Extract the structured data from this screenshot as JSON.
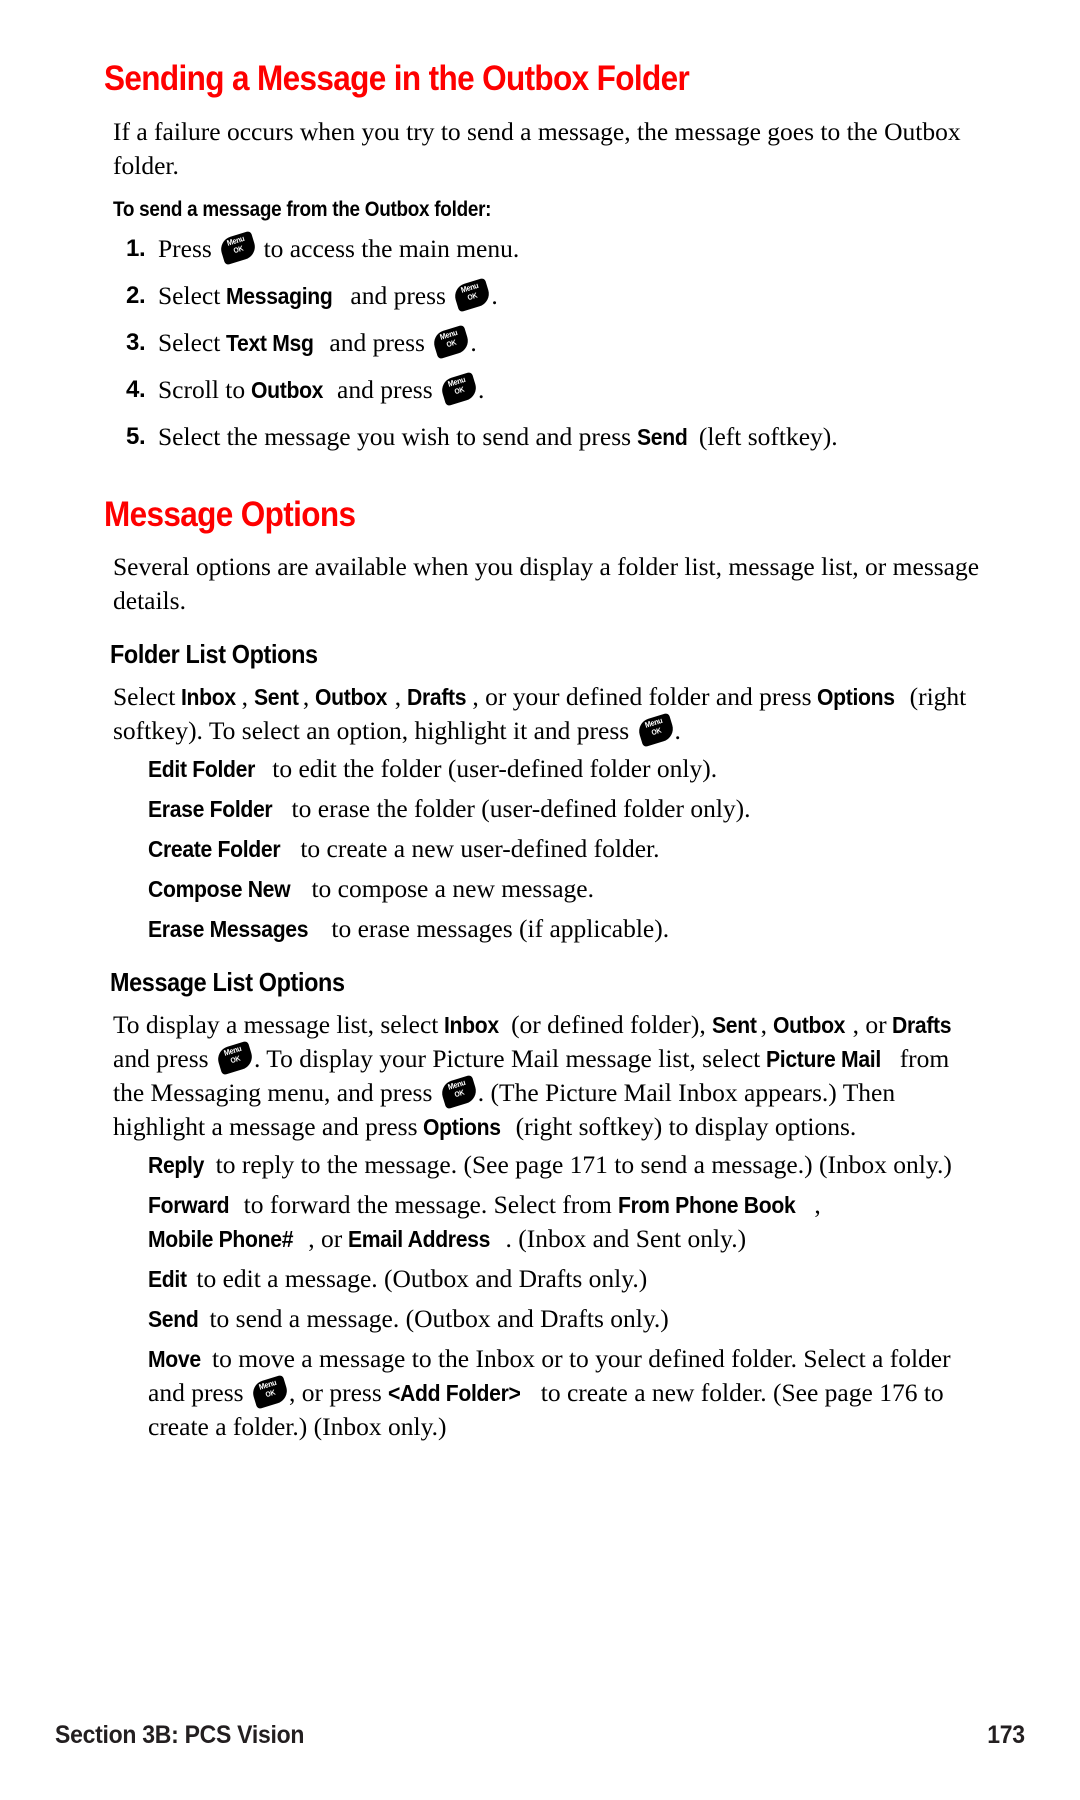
{
  "page": {
    "number": "173",
    "section_label": "Section 3B: PCS Vision",
    "accent_color": "#fe0000",
    "text_color": "#000000"
  },
  "icons": {
    "menu_ok_key": {
      "line1": "Menu",
      "line2": "OK",
      "name": "menu-ok-key-icon"
    }
  },
  "section1": {
    "heading": "Sending a Message in the Outbox Folder",
    "intro": "If a failure occurs when you try to send a message, the message goes to the Outbox folder.",
    "procedure_title": "To send a message from the Outbox folder:",
    "steps": [
      {
        "num": "1.",
        "pre": "Press ",
        "bold1": "",
        "post": " to access the main menu.",
        "tail": ""
      },
      {
        "num": "2.",
        "pre": "Select ",
        "bold1": "Messaging",
        "mid": " and press ",
        "post": ".",
        "tail": ""
      },
      {
        "num": "3.",
        "pre": "Select ",
        "bold1": "Text Msg",
        "mid": " and press ",
        "post": ".",
        "tail": ""
      },
      {
        "num": "4.",
        "pre": "Scroll to ",
        "bold1": "Outbox",
        "mid": " and press ",
        "post": ".",
        "tail": ""
      },
      {
        "num": "5.",
        "pre": "Select the message you wish to send and press ",
        "bold1": "Send",
        "mid": " (left softkey).",
        "post": "",
        "tail": ""
      }
    ]
  },
  "section2": {
    "heading": "Message Options",
    "intro": "Several options are available when you display a folder list, message list, or message details.",
    "folder_list": {
      "heading": "Folder List Options",
      "lead": {
        "t1": "Select ",
        "b1": "Inbox",
        "t2": ", ",
        "b2": "Sent",
        "t3": ", ",
        "b3": "Outbox",
        "t4": ", ",
        "b4": "Drafts",
        "t5": ", or your defined folder and press ",
        "b5": "Options",
        "t6": " (right softkey). To select an option, highlight it and press ",
        "t7": "."
      },
      "options": [
        {
          "term": "Edit Folder",
          "desc": " to edit the folder (user-defined folder only)."
        },
        {
          "term": "Erase Folder",
          "desc": " to erase the folder (user-defined folder only)."
        },
        {
          "term": "Create Folder",
          "desc": " to create a new user-defined folder."
        },
        {
          "term": "Compose New",
          "desc": " to compose a new message."
        },
        {
          "term": "Erase Messages",
          "desc": " to erase messages (if applicable)."
        }
      ]
    },
    "message_list": {
      "heading": "Message List Options",
      "lead": {
        "t1": "To display a message list, select ",
        "b1": "Inbox",
        "t2": " (or defined folder), ",
        "b2": "Sent",
        "t3": ", ",
        "b3": "Outbox",
        "t4": ", or ",
        "b4": "Drafts",
        "t5": " and press ",
        "t6": ". To display your Picture Mail message list, select ",
        "b5": "Picture Mail",
        "t7": " from the Messaging menu, and press ",
        "t8": ". (The Picture Mail Inbox appears.) Then highlight a message and press ",
        "b6": "Options",
        "t9": " (right softkey) to display options."
      },
      "options": [
        {
          "term": "Reply",
          "desc": " to reply to the message. (See page 171 to send a message.) (Inbox only.)"
        },
        {
          "term": "Forward",
          "desc_1": " to forward the message. Select from ",
          "b1": "From Phone Book",
          "desc_2": ", ",
          "b2": "Mobile Phone#",
          "desc_3": ", or ",
          "b3": "Email Address",
          "desc_4": ". (Inbox and Sent only.)"
        },
        {
          "term": "Edit",
          "desc": " to edit a message. (Outbox and Drafts only.)"
        },
        {
          "term": "Send",
          "desc": " to send a message. (Outbox and Drafts only.)"
        },
        {
          "term": "Move",
          "desc_1": " to move a message to the Inbox or to your defined folder. Select a folder and press ",
          "desc_2": ", or press ",
          "b1": "<Add Folder>",
          "desc_3": " to create a new folder. (See page 176 to create a folder.) (Inbox only.)"
        }
      ]
    }
  }
}
